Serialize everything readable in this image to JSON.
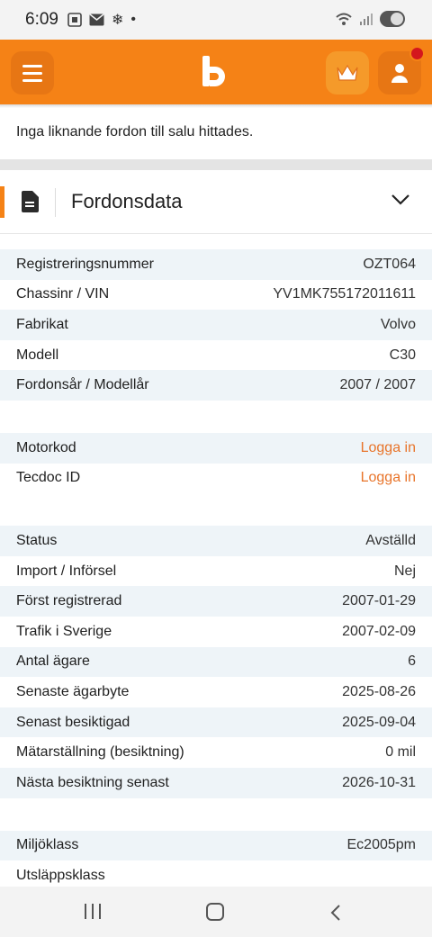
{
  "status_bar": {
    "time": "6:09",
    "icons": [
      "screenshot-icon",
      "mail-icon",
      "fan-icon",
      "dot-icon"
    ]
  },
  "message": "Inga liknande fordon till salu hittades.",
  "section": {
    "title": "Fordonsdata"
  },
  "groups": [
    [
      {
        "label": "Registreringsnummer",
        "value": "OZT064"
      },
      {
        "label": "Chassinr / VIN",
        "value": "YV1MK755172011611"
      },
      {
        "label": "Fabrikat",
        "value": "Volvo"
      },
      {
        "label": "Modell",
        "value": "C30"
      },
      {
        "label": "Fordonsår / Modellår",
        "value": "2007 / 2007"
      }
    ],
    [
      {
        "label": "Motorkod",
        "value": "Logga in",
        "link": true
      },
      {
        "label": "Tecdoc ID",
        "value": "Logga in",
        "link": true
      }
    ],
    [
      {
        "label": "Status",
        "value": "Avställd"
      },
      {
        "label": "Import / Införsel",
        "value": "Nej"
      },
      {
        "label": "Först registrerad",
        "value": "2007-01-29"
      },
      {
        "label": "Trafik i Sverige",
        "value": "2007-02-09"
      },
      {
        "label": "Antal ägare",
        "value": "6"
      },
      {
        "label": "Senaste ägarbyte",
        "value": "2025-08-26"
      },
      {
        "label": "Senast besiktigad",
        "value": "2025-09-04"
      },
      {
        "label": "Mätarställning (besiktning)",
        "value": "0 mil"
      },
      {
        "label": "Nästa besiktning senast",
        "value": "2026-10-31"
      }
    ],
    [
      {
        "label": "Miljöklass",
        "value": "Ec2005pm"
      },
      {
        "label": "Utsläppsklass",
        "value": ""
      }
    ]
  ],
  "colors": {
    "brand": "#f58216",
    "link": "#e8742a",
    "row_shade": "#eef4f8"
  }
}
